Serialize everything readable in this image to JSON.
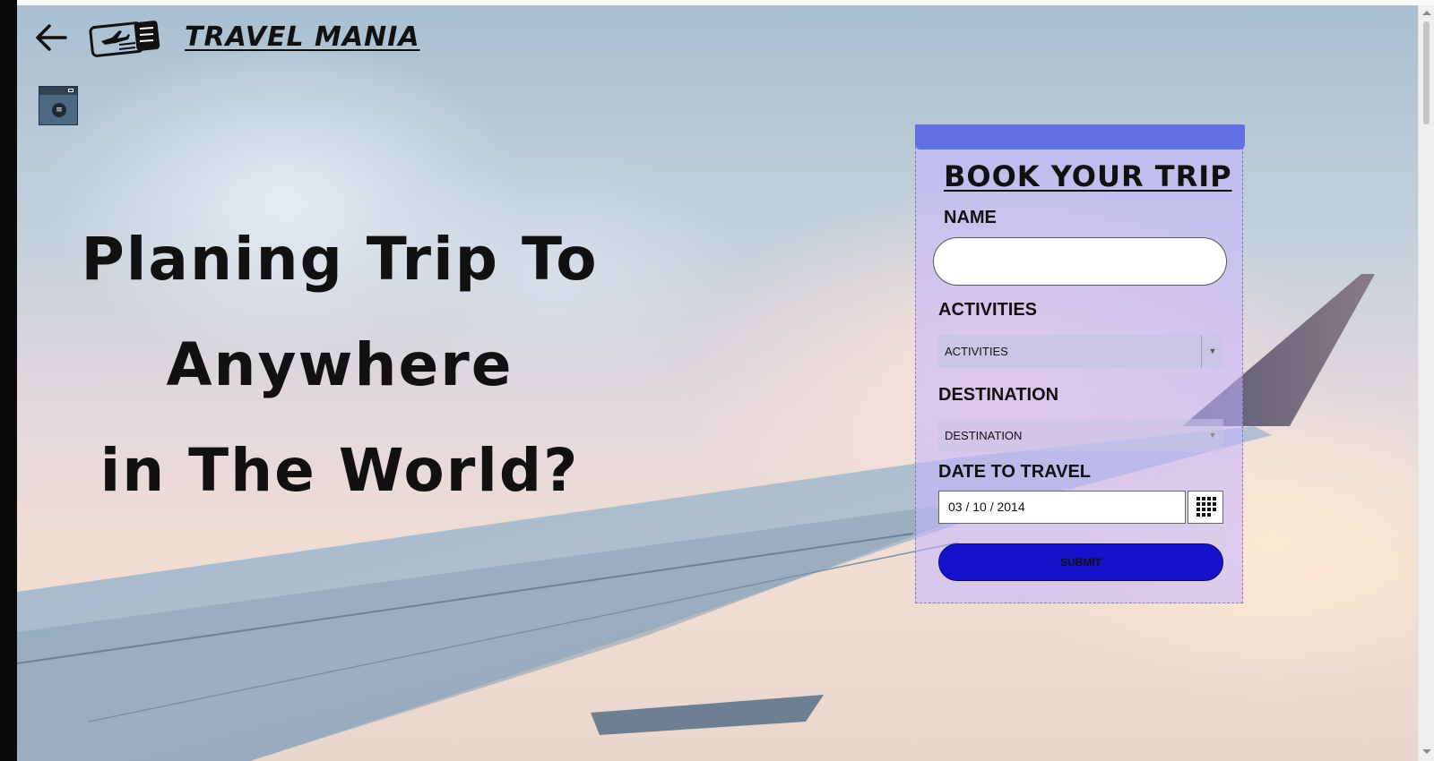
{
  "brand": {
    "title": "TRAVEL MANIA"
  },
  "hero": {
    "line1": "Planing Trip To",
    "line2": "Anywhere",
    "line3": "in The World?"
  },
  "booking_form": {
    "title": "BOOK YOUR TRIP",
    "name_label": "NAME",
    "name_value": "",
    "activities_label": "ACTIVITIES",
    "activities_selected": "ACTIVITIES",
    "destination_label": "DESTINATION",
    "destination_selected": "DESTINATION",
    "date_label": "DATE TO TRAVEL",
    "date_value": "03 / 10 / 2014",
    "submit_label": "SUBMIT"
  },
  "colors": {
    "panel_header": "#6270e6",
    "submit_button": "#1512c9",
    "panel_background": "#c4b4ff"
  },
  "icons": [
    "back-arrow-icon",
    "ticket-plane-icon",
    "menu-widget-icon",
    "calendar-grid-icon",
    "dropdown-arrow-icon"
  ]
}
